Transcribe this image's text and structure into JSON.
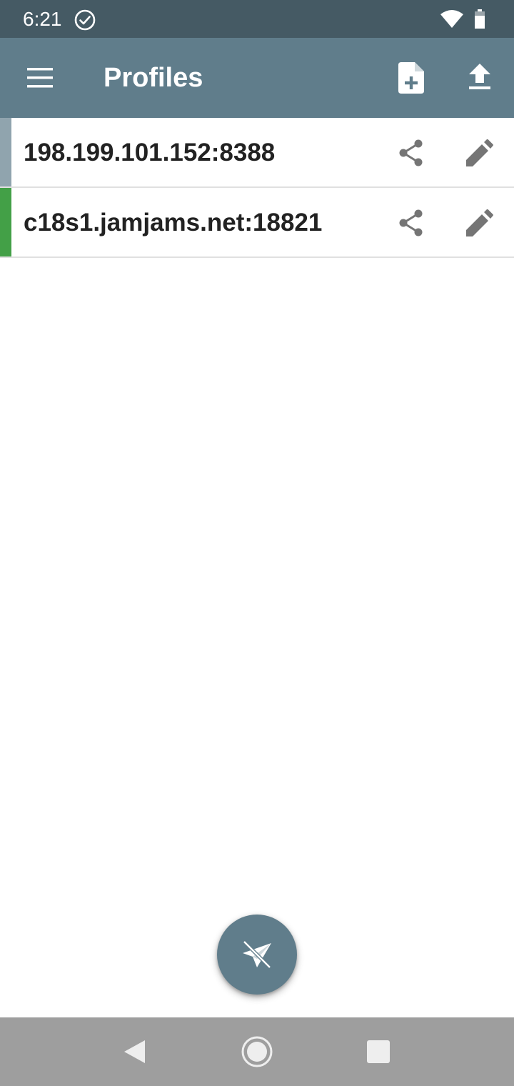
{
  "status_bar": {
    "time": "6:21",
    "icons": [
      "check-circle-icon",
      "wifi-icon",
      "battery-icon"
    ]
  },
  "app_bar": {
    "title": "Profiles",
    "icons": [
      "menu-icon",
      "note-add-icon",
      "upload-icon"
    ]
  },
  "profiles": [
    {
      "name": "198.199.101.152:8388",
      "indicator_color": "#90a4ae",
      "selected": false
    },
    {
      "name": "c18s1.jamjams.net:18821",
      "indicator_color": "#43a047",
      "selected": true
    }
  ],
  "row_icons": [
    "share-icon",
    "edit-pencil-icon"
  ],
  "fab": {
    "icon": "paper-plane-off-icon"
  },
  "nav_bar": {
    "icons": [
      "back-triangle-icon",
      "home-circle-icon",
      "recents-square-icon"
    ]
  },
  "colors": {
    "status_bar": "#455a64",
    "app_bar": "#607d8b",
    "fab": "#607d8b",
    "nav_bar": "#9e9e9e",
    "row_icon": "#757575"
  }
}
